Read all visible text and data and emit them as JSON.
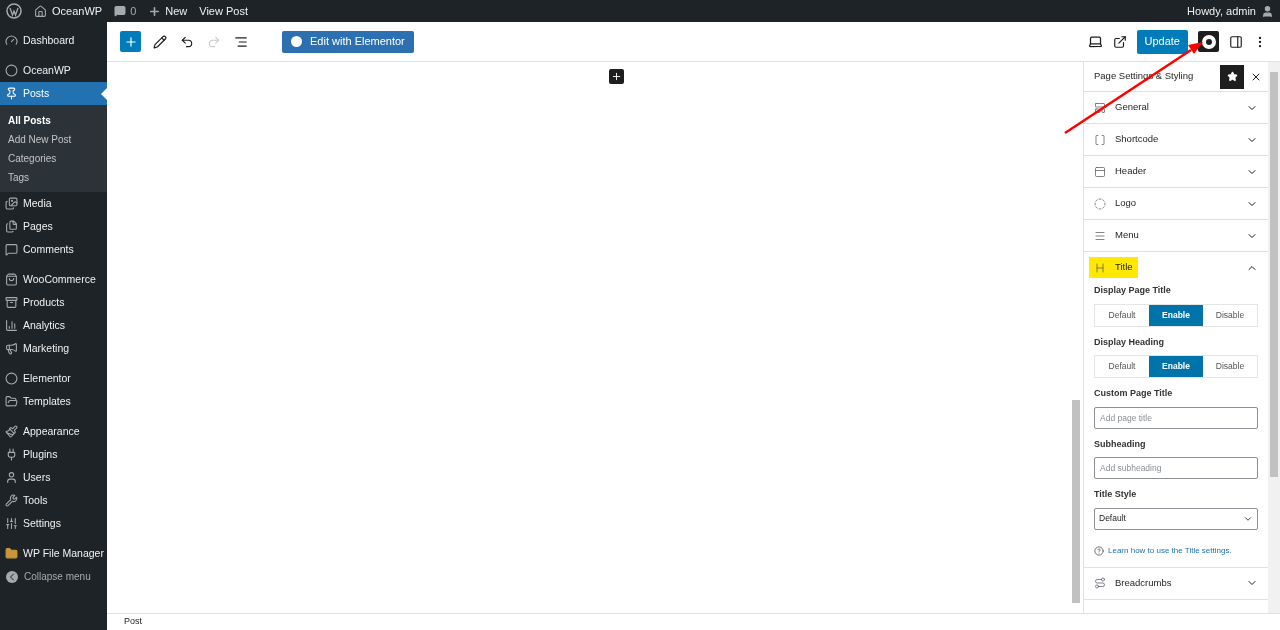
{
  "admin_bar": {
    "site_name": "OceanWP",
    "comments_count": "0",
    "new_label": "New",
    "view_post": "View Post",
    "greeting": "Howdy, admin"
  },
  "admin_menu": {
    "groups": [
      [
        {
          "label": "Dashboard",
          "selected": false
        }
      ],
      [
        {
          "label": "OceanWP",
          "selected": false
        },
        {
          "label": "Posts",
          "selected": true,
          "children": [
            {
              "label": "All Posts",
              "selected": true
            },
            {
              "label": "Add New Post",
              "selected": false
            },
            {
              "label": "Categories",
              "selected": false
            },
            {
              "label": "Tags",
              "selected": false
            }
          ]
        },
        {
          "label": "Media",
          "selected": false
        },
        {
          "label": "Pages",
          "selected": false
        },
        {
          "label": "Comments",
          "selected": false
        }
      ],
      [
        {
          "label": "WooCommerce",
          "selected": false
        },
        {
          "label": "Products",
          "selected": false
        },
        {
          "label": "Analytics",
          "selected": false
        },
        {
          "label": "Marketing",
          "selected": false
        }
      ],
      [
        {
          "label": "Elementor",
          "selected": false
        },
        {
          "label": "Templates",
          "selected": false
        }
      ],
      [
        {
          "label": "Appearance",
          "selected": false
        },
        {
          "label": "Plugins",
          "selected": false
        },
        {
          "label": "Users",
          "selected": false
        },
        {
          "label": "Tools",
          "selected": false
        },
        {
          "label": "Settings",
          "selected": false
        }
      ],
      [
        {
          "label": "WP File Manager",
          "selected": false
        }
      ]
    ],
    "collapse_label": "Collapse menu"
  },
  "editor_toolbar": {
    "tools": [
      {
        "disabled": false
      },
      {
        "disabled": false
      },
      {
        "disabled": true
      },
      {
        "disabled": false
      }
    ],
    "elementor_button": "Edit with Elementor",
    "update_button": "Update",
    "settings_active": true
  },
  "settings_panel": {
    "title": "Page Settings & Styling",
    "sections": [
      {
        "label": "General",
        "expanded": false,
        "highlighted": false
      },
      {
        "label": "Shortcode",
        "expanded": false,
        "highlighted": false
      },
      {
        "label": "Header",
        "expanded": false,
        "highlighted": false
      },
      {
        "label": "Logo",
        "expanded": false,
        "highlighted": false
      },
      {
        "label": "Menu",
        "expanded": false,
        "highlighted": false
      },
      {
        "label": "Title",
        "expanded": true,
        "highlighted": true,
        "fields": [
          {
            "kind": "toggle",
            "label": "Display Page Title",
            "options": [
              {
                "label": "Default",
                "selected": false
              },
              {
                "label": "Enable",
                "selected": true
              },
              {
                "label": "Disable",
                "selected": false
              }
            ]
          },
          {
            "kind": "toggle",
            "label": "Display Heading",
            "options": [
              {
                "label": "Default",
                "selected": false
              },
              {
                "label": "Enable",
                "selected": true
              },
              {
                "label": "Disable",
                "selected": false
              }
            ]
          },
          {
            "kind": "text",
            "label": "Custom Page Title",
            "placeholder": "Add page title"
          },
          {
            "kind": "text",
            "label": "Subheading",
            "placeholder": "Add subheading"
          },
          {
            "kind": "select",
            "label": "Title Style",
            "value": "Default"
          }
        ],
        "help_link": "Learn how to use the Title settings."
      },
      {
        "label": "Breadcrumbs",
        "expanded": false,
        "highlighted": false
      }
    ]
  },
  "footer": {
    "breadcrumb": "Post"
  }
}
